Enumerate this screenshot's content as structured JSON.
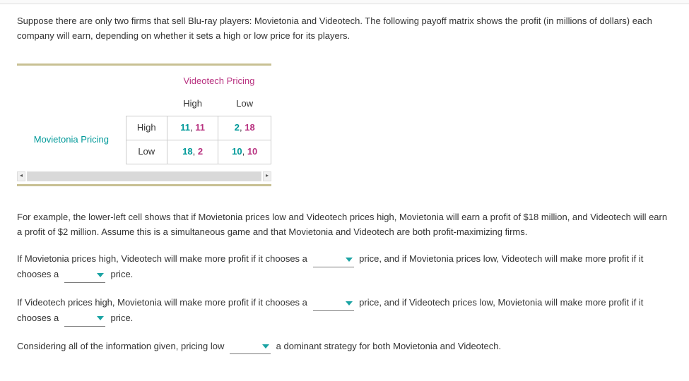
{
  "intro": "Suppose there are only two firms that sell Blu-ray players: Movietonia and Videotech. The following payoff matrix shows the profit (in millions of dollars) each company will earn, depending on whether it sets a high or low price for its players.",
  "matrix": {
    "col_player_label": "Videotech Pricing",
    "row_player_label": "Movietonia Pricing",
    "col_headers": [
      "High",
      "Low"
    ],
    "row_headers": [
      "High",
      "Low"
    ],
    "cells": {
      "hh": {
        "p1": "11",
        "sep": ", ",
        "p2": "11"
      },
      "hl": {
        "p1": "2",
        "sep": ", ",
        "p2": "18"
      },
      "lh": {
        "p1": "18",
        "sep": ", ",
        "p2": "2"
      },
      "ll": {
        "p1": "10",
        "sep": ", ",
        "p2": "10"
      }
    }
  },
  "explain": "For example, the lower-left cell shows that if Movietonia prices low and Videotech prices high, Movietonia will earn a profit of $18 million, and Videotech will earn a profit of $2 million. Assume this is a simultaneous game and that Movietonia and Videotech are both profit-maximizing firms.",
  "q1": {
    "t1": "If Movietonia prices high, Videotech will make more profit if it chooses a ",
    "t2": " price, and if Movietonia prices low, Videotech will make more profit if it chooses a ",
    "t3": " price."
  },
  "q2": {
    "t1": "If Videotech prices high, Movietonia will make more profit if it chooses a ",
    "t2": " price, and if Videotech prices low, Movietonia will make more profit if it chooses a ",
    "t3": " price."
  },
  "q3": {
    "t1": "Considering all of the information given, pricing low ",
    "t2": " a dominant strategy for both Movietonia and Videotech."
  }
}
